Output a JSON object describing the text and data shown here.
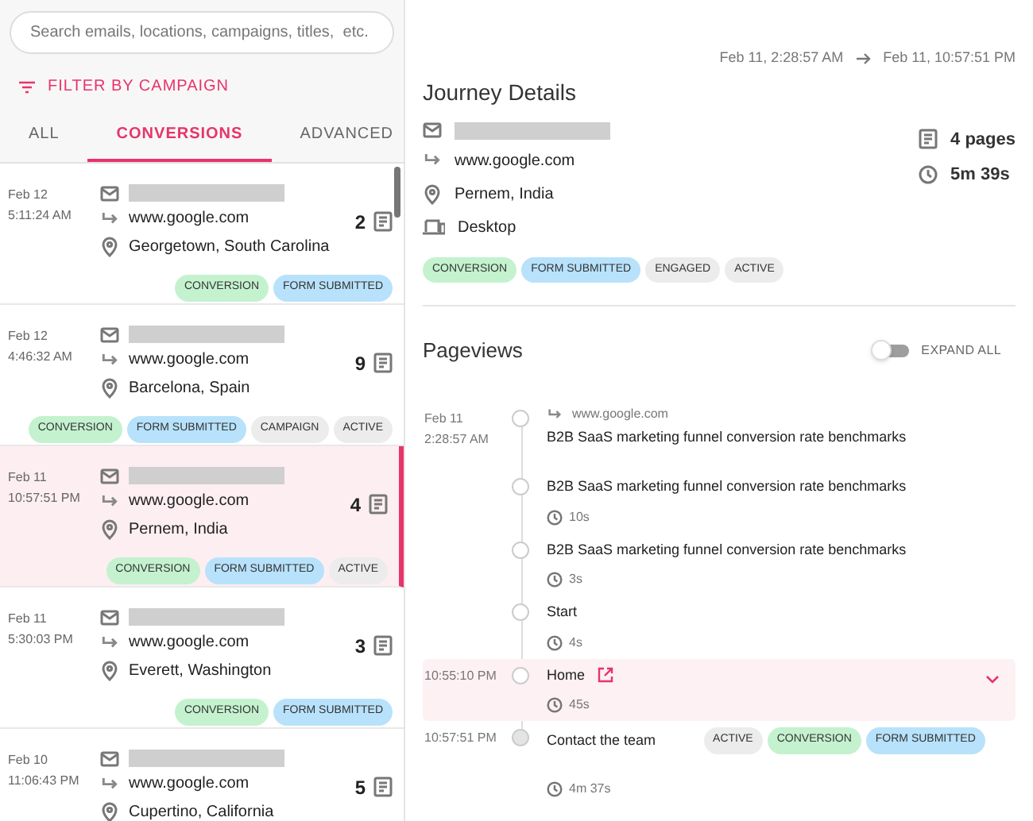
{
  "search": {
    "placeholder": "Search emails, locations, campaigns, titles,  etc."
  },
  "filter": {
    "label": "FILTER BY CAMPAIGN"
  },
  "tabs": [
    {
      "label": "ALL",
      "selected": false
    },
    {
      "label": "CONVERSIONS",
      "selected": true
    },
    {
      "label": "ADVANCED",
      "selected": false
    }
  ],
  "journeys": [
    {
      "date": "Feb 12",
      "time": "5:11:24 AM",
      "referrer": "www.google.com",
      "location": "Georgetown, South Carolina",
      "pages": "2",
      "selected": false,
      "tags": [
        {
          "label": "CONVERSION",
          "kind": "conversion"
        },
        {
          "label": "FORM SUBMITTED",
          "kind": "form"
        }
      ]
    },
    {
      "date": "Feb 12",
      "time": "4:46:32 AM",
      "referrer": "www.google.com",
      "location": "Barcelona, Spain",
      "pages": "9",
      "selected": false,
      "tags": [
        {
          "label": "CONVERSION",
          "kind": "conversion"
        },
        {
          "label": "FORM SUBMITTED",
          "kind": "form"
        },
        {
          "label": "CAMPAIGN",
          "kind": "plain"
        },
        {
          "label": "ACTIVE",
          "kind": "plain"
        }
      ]
    },
    {
      "date": "Feb 11",
      "time": "10:57:51 PM",
      "referrer": "www.google.com",
      "location": "Pernem, India",
      "pages": "4",
      "selected": true,
      "tags": [
        {
          "label": "CONVERSION",
          "kind": "conversion"
        },
        {
          "label": "FORM SUBMITTED",
          "kind": "form"
        },
        {
          "label": "ACTIVE",
          "kind": "plain"
        }
      ]
    },
    {
      "date": "Feb 11",
      "time": "5:30:03 PM",
      "referrer": "www.google.com",
      "location": "Everett, Washington",
      "pages": "3",
      "selected": false,
      "tags": [
        {
          "label": "CONVERSION",
          "kind": "conversion"
        },
        {
          "label": "FORM SUBMITTED",
          "kind": "form"
        }
      ]
    },
    {
      "date": "Feb 10",
      "time": "11:06:43 PM",
      "referrer": "www.google.com",
      "location": "Cupertino, California",
      "pages": "5",
      "selected": false
    }
  ],
  "details": {
    "range_start": "Feb 11, 2:28:57 AM",
    "range_end": "Feb 11, 10:57:51 PM",
    "title": "Journey Details",
    "referrer": "www.google.com",
    "location": "Pernem, India",
    "device": "Desktop",
    "pages": "4 pages",
    "duration": "5m 39s",
    "tags": [
      {
        "label": "CONVERSION",
        "kind": "conversion"
      },
      {
        "label": "FORM SUBMITTED",
        "kind": "form"
      },
      {
        "label": "ENGAGED",
        "kind": "plain"
      },
      {
        "label": "ACTIVE",
        "kind": "plain"
      }
    ]
  },
  "pageviews": {
    "title": "Pageviews",
    "expand_all": {
      "label": "EXPAND ALL",
      "on": false
    },
    "items": [
      {
        "date": "Feb 11",
        "time": "2:28:57 AM",
        "referrer": "www.google.com",
        "title": "B2B SaaS marketing funnel conversion rate benchmarks",
        "selected": false,
        "current": false
      },
      {
        "title": "B2B SaaS marketing funnel conversion rate benchmarks",
        "duration": "10s",
        "selected": false,
        "current": false
      },
      {
        "title": "B2B SaaS marketing funnel conversion rate benchmarks",
        "duration": "3s",
        "selected": false,
        "current": false
      },
      {
        "title": "Start",
        "duration": "4s",
        "selected": false,
        "current": false
      },
      {
        "time": "10:55:10 PM",
        "title": "Home",
        "link": true,
        "duration": "45s",
        "selected": true,
        "current": false
      },
      {
        "time": "10:57:51 PM",
        "title": "Contact the team",
        "duration": "4m 37s",
        "selected": false,
        "current": true,
        "tags": [
          {
            "label": "ACTIVE",
            "kind": "plain"
          },
          {
            "label": "CONVERSION",
            "kind": "conversion"
          },
          {
            "label": "FORM SUBMITTED",
            "kind": "form"
          }
        ]
      }
    ]
  }
}
